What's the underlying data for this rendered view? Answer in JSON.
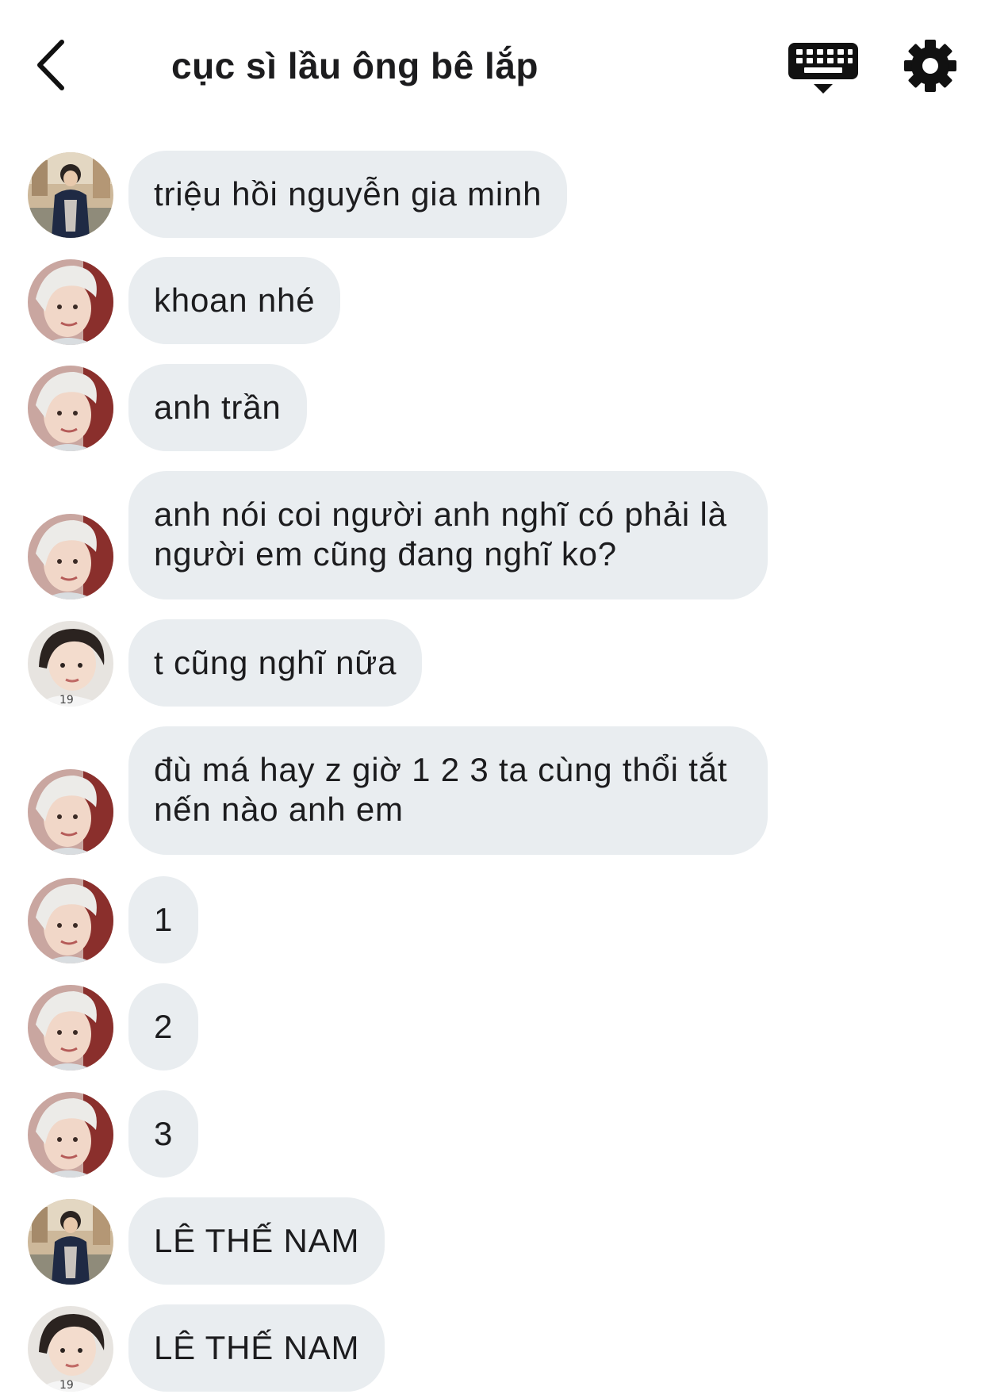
{
  "header": {
    "title": "cục sì lầu ông bê lắp"
  },
  "messages": [
    {
      "avatar": "avatar-dark-jacket",
      "text": "triệu hồi nguyễn gia minh"
    },
    {
      "avatar": "avatar-white-hair",
      "text": "khoan nhé"
    },
    {
      "avatar": "avatar-white-hair",
      "text": "anh trần"
    },
    {
      "avatar": "avatar-white-hair",
      "text": "anh nói coi người anh nghĩ có phải là người em cũng đang nghĩ ko?"
    },
    {
      "avatar": "avatar-dark-hair",
      "text": "t cũng nghĩ nữa"
    },
    {
      "avatar": "avatar-white-hair",
      "text": "đù má hay z giờ 1 2 3 ta cùng thổi tắt nến nào anh em"
    },
    {
      "avatar": "avatar-white-hair",
      "text": "1"
    },
    {
      "avatar": "avatar-white-hair",
      "text": "2"
    },
    {
      "avatar": "avatar-white-hair",
      "text": "3"
    },
    {
      "avatar": "avatar-dark-jacket",
      "text": "LÊ THẾ NAM"
    },
    {
      "avatar": "avatar-dark-hair",
      "text": "LÊ THẾ NAM"
    }
  ],
  "colors": {
    "bubble": "#e9edf0",
    "text": "#1c1c1e",
    "icon": "#111111"
  },
  "icons": {
    "back": "chevron-left-icon",
    "keyboard": "keyboard-icon",
    "settings": "gear-icon"
  }
}
